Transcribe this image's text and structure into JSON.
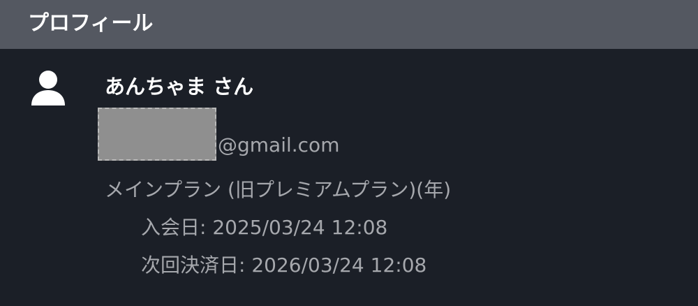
{
  "header": {
    "title": "プロフィール"
  },
  "profile": {
    "avatar_icon": "user-icon",
    "name": "あんちゃま さん",
    "email_masked": true,
    "email_domain": "@gmail.com",
    "plan": "メインプラン (旧プレミアムプラン)(年)",
    "join_label": "入会日:",
    "join_date": "2025/03/24 12:08",
    "next_billing_label": "次回決済日:",
    "next_billing_date": "2026/03/24 12:08"
  },
  "colors": {
    "background": "#1b1f27",
    "header_background": "#545861",
    "primary_text": "#ffffff",
    "secondary_text": "#a6a8ad",
    "mask": "#8f8f8f"
  }
}
